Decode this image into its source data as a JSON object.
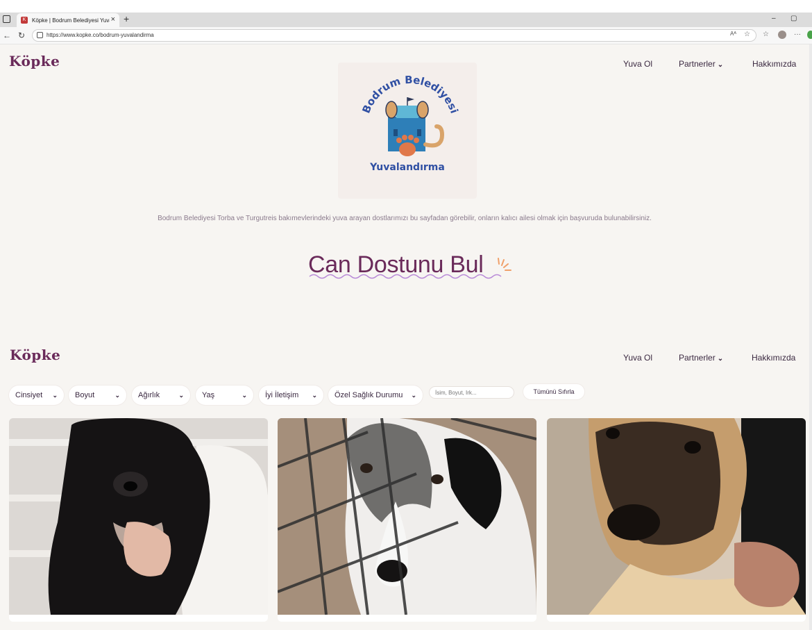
{
  "browser": {
    "tab_title": "Köpke | Bodrum Belediyesi Yuvalandırma",
    "url": "https://www.kopke.co/bodrum-yuvalandirma",
    "new_tab": "+",
    "close": "×"
  },
  "header": {
    "logo": "Köpke",
    "nav": [
      "Yuva Ol",
      "Partnerler",
      "Hakkımızda"
    ]
  },
  "hero": {
    "arc_text": "Bodrum Belediyesi",
    "sub_text": "Yuvalandırma",
    "description": "Bodrum Belediyesi Torba ve Turgutreis bakımevlerindeki yuva arayan dostlarımızı bu sayfadan görebilir, onların kalıcı ailesi olmak için başvuruda bulunabilirsiniz."
  },
  "section": {
    "heading": "Can Dostunu Bul"
  },
  "sticky_header": {
    "logo": "Köpke",
    "nav": [
      "Yuva Ol",
      "Partnerler",
      "Hakkımızda"
    ]
  },
  "filters": {
    "dropdowns": [
      "Cinsiyet",
      "Boyut",
      "Ağırlık",
      "Yaş",
      "İyi İletişim",
      "Özel Sağlık Durumu"
    ],
    "search_placeholder": "İsim, Boyut, Irk...",
    "reset_label": "Tümünü Sıfırla"
  },
  "cards": [
    {
      "alt": "black fluffy puppy"
    },
    {
      "alt": "black and white dog behind fence"
    },
    {
      "alt": "tan puppy with dark muzzle"
    }
  ],
  "colors": {
    "brand": "#6a2a5a",
    "page_bg": "#f7f5f2"
  }
}
